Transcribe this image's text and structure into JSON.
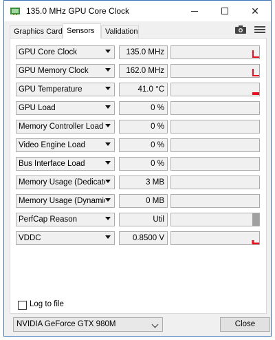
{
  "window": {
    "title": "135.0 MHz GPU Core Clock"
  },
  "tabs": [
    {
      "label": "Graphics Card",
      "active": false
    },
    {
      "label": "Sensors",
      "active": true
    },
    {
      "label": "Validation",
      "active": false
    }
  ],
  "toolbar_icons": [
    "camera-icon",
    "hamburger-menu-icon"
  ],
  "sensors": [
    {
      "name": "GPU Core Clock",
      "value": "135.0 MHz",
      "graph": "step",
      "level": 0.55
    },
    {
      "name": "GPU Memory Clock",
      "value": "162.0 MHz",
      "graph": "step",
      "level": 0.55
    },
    {
      "name": "GPU Temperature",
      "value": "41.0 °C",
      "graph": "bar",
      "level": 0.2
    },
    {
      "name": "GPU Load",
      "value": "0 %",
      "graph": "none",
      "level": 0
    },
    {
      "name": "Memory Controller Load",
      "value": "0 %",
      "graph": "none",
      "level": 0
    },
    {
      "name": "Video Engine Load",
      "value": "0 %",
      "graph": "none",
      "level": 0
    },
    {
      "name": "Bus Interface Load",
      "value": "0 %",
      "graph": "none",
      "level": 0
    },
    {
      "name": "Memory Usage (Dedicated)",
      "value": "3 MB",
      "graph": "none",
      "level": 0
    },
    {
      "name": "Memory Usage (Dynamic)",
      "value": "0 MB",
      "graph": "none",
      "level": 0
    },
    {
      "name": "PerfCap Reason",
      "value": "Util",
      "graph": "gray",
      "level": 1.0
    },
    {
      "name": "VDDC",
      "value": "0.8500 V",
      "graph": "step-small",
      "level": 0.3
    }
  ],
  "colors": {
    "graph_red": "#e8101e",
    "graph_gray": "#a0a0a0",
    "title_border": "#3c74b8"
  },
  "footer": {
    "log_label": "Log to file",
    "log_checked": false,
    "device": "NVIDIA GeForce GTX 980M",
    "close_label": "Close"
  }
}
